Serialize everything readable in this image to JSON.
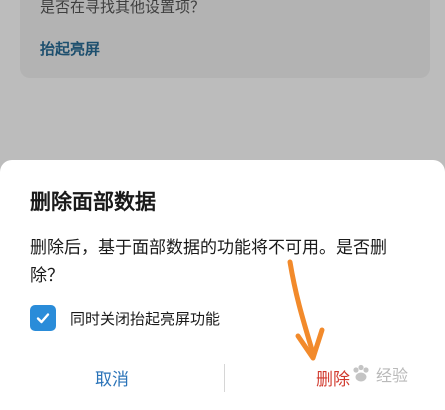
{
  "background": {
    "question": "是否在寻找其他设置项？",
    "link": "抬起亮屏"
  },
  "dialog": {
    "title": "删除面部数据",
    "message": "删除后，基于面部数据的功能将不可用。是否删除？",
    "checkbox_label": "同时关闭抬起亮屏功能",
    "checkbox_checked": true,
    "cancel_label": "取消",
    "delete_label": "删除"
  },
  "annotation": {
    "arrow_color": "#f28a2b"
  },
  "watermark": {
    "text": "经验"
  },
  "colors": {
    "accent": "#2a8cd9",
    "danger": "#d13a2e",
    "link": "#2a73b8"
  }
}
